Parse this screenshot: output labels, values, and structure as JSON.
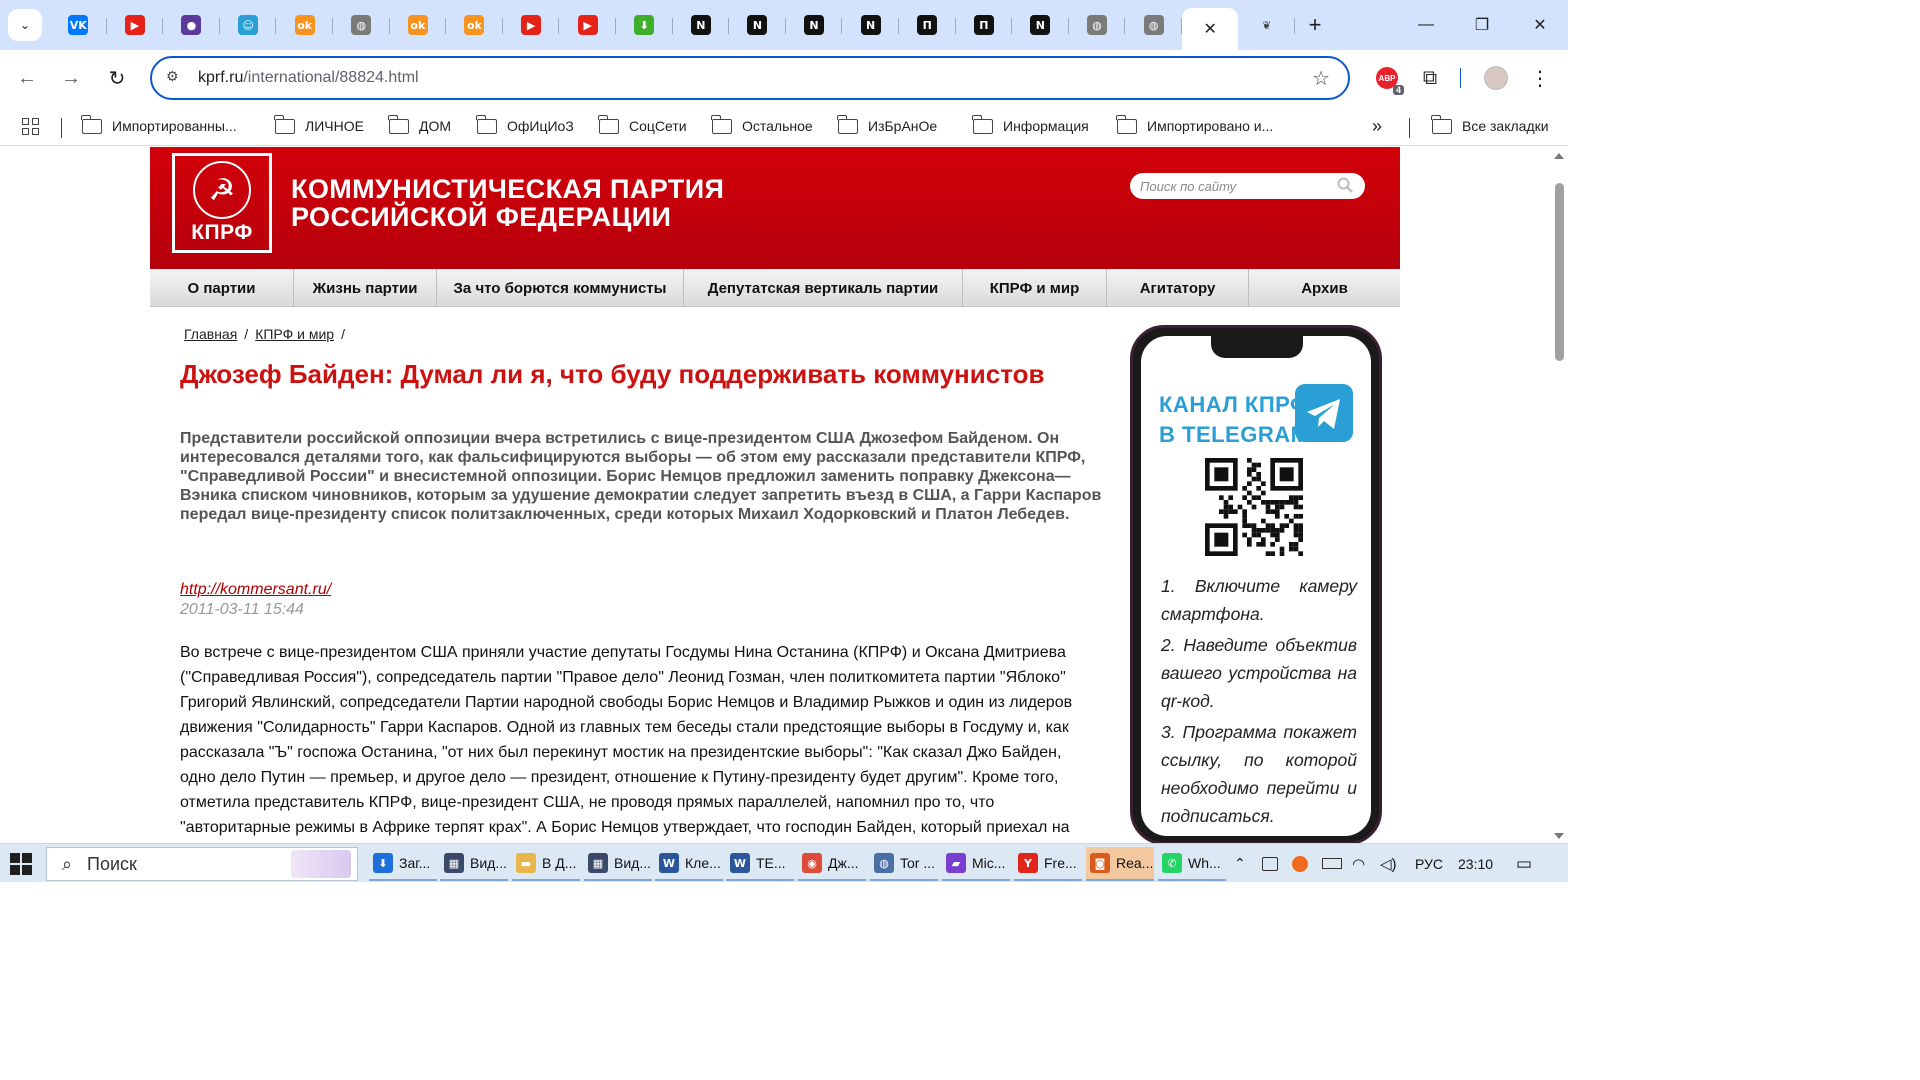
{
  "browser": {
    "tabs": [
      {
        "icon": "vk-icon",
        "glyph": "VK",
        "color": "#0077ff"
      },
      {
        "icon": "youtube-icon",
        "glyph": "▶",
        "color": "#e62117"
      },
      {
        "icon": "profile-icon",
        "glyph": "●",
        "color": "#5b3a9b"
      },
      {
        "icon": "smile-icon",
        "glyph": "☺",
        "color": "#2a9fd6"
      },
      {
        "icon": "ok-icon",
        "glyph": "ok",
        "color": "#f7931e"
      },
      {
        "icon": "globe-icon",
        "glyph": "◍",
        "color": "#7a7a7a"
      },
      {
        "icon": "ok-icon",
        "glyph": "ok",
        "color": "#f7931e"
      },
      {
        "icon": "ok-icon",
        "glyph": "ok",
        "color": "#f7931e"
      },
      {
        "icon": "youtube-icon",
        "glyph": "▶",
        "color": "#e62117"
      },
      {
        "icon": "youtube-icon",
        "glyph": "▶",
        "color": "#e62117"
      },
      {
        "icon": "download-icon",
        "glyph": "⬇",
        "color": "#3fae2a"
      },
      {
        "icon": "nf-icon",
        "glyph": "N",
        "color": "#111111"
      },
      {
        "icon": "nf-icon",
        "glyph": "N",
        "color": "#111111"
      },
      {
        "icon": "nf-icon",
        "glyph": "N",
        "color": "#111111"
      },
      {
        "icon": "nf-icon",
        "glyph": "N",
        "color": "#111111"
      },
      {
        "icon": "p-icon",
        "glyph": "П",
        "color": "#111111"
      },
      {
        "icon": "p-icon",
        "glyph": "П",
        "color": "#111111"
      },
      {
        "icon": "nf-icon",
        "glyph": "N",
        "color": "#111111"
      },
      {
        "icon": "globe-icon",
        "glyph": "◍",
        "color": "#7a7a7a"
      },
      {
        "icon": "globe-icon",
        "glyph": "◍",
        "color": "#7a7a7a"
      }
    ],
    "active_tab_close": "✕",
    "url_host": "kprf.ru",
    "url_path": "/international/88824.html",
    "extension_badge": "4",
    "bookmarks": [
      "Импортированны...",
      "ЛИЧНОЕ",
      "ДОМ",
      "ОфИцИоЗ",
      "СоцСети",
      "Остальное",
      "ИзБрАнОе",
      "Информация",
      "Импортировано и..."
    ],
    "bookmarks_more": "»",
    "all_bookmarks": "Все закладки"
  },
  "site": {
    "logo_text": "КПРФ",
    "title_line1": "КОММУНИСТИЧЕСКАЯ ПАРТИЯ",
    "title_line2": "РОССИЙСКОЙ ФЕДЕРАЦИИ",
    "search_placeholder": "Поиск по сайту",
    "nav": [
      "О партии",
      "Жизнь партии",
      "За что борются коммунисты",
      "Депутатская вертикаль партии",
      "КПРФ и мир",
      "Агитатору",
      "Архив"
    ],
    "brand_red": "#cc1111"
  },
  "breadcrumb": {
    "home": "Главная",
    "section": "КПРФ и мир",
    "sep": "/"
  },
  "article": {
    "title": "Джозеф Байден: Думал ли я, что буду поддерживать коммунистов",
    "lead": "Представители российской оппозиции вчера встретились с вице-президентом США Джозефом Байденом. Он интересовался деталями того, как фальсифицируются выборы — об этом ему рассказали представители КПРФ, \"Справедливой России\" и внесистемной оппозиции. Борис Немцов предложил заменить поправку Джексона—Вэника списком чиновников, которым за удушение демократии следует запретить въезд в США, а Гарри Каспаров передал вице-президенту список политзаключенных, среди которых Михаил Ходорковский и Платон Лебедев.",
    "source_link": "http://kommersant.ru/",
    "date": "2011-03-11 15:44",
    "body": "Во встрече с вице-президентом США приняли участие депутаты Госдумы Нина Останина (КПРФ) и Оксана Дмитриева (\"Справедливая Россия\"), сопредседатель партии \"Правое дело\" Леонид Гозман, член политкомитета партии \"Яблоко\" Григорий Явлинский, сопредседатели Партии народной свободы Борис Немцов и Владимир Рыжков и один из лидеров движения \"Солидарность\" Гарри Каспаров. Одной из главных тем беседы стали предстоящие выборы в Госдуму и, как рассказала \"Ъ\" госпожа Останина, \"от них был перекинут мостик на президентские выборы\": \"Как сказал Джо Байден, одно дело Путин — премьер, и другое дело — президент, отношение к Путину-президенту будет другим\". Кроме того, отметила представитель КПРФ, вице-президент США, не проводя прямых параллелей, напомнил про то, что \"авторитарные режимы в Африке терпят крах\". А Борис Немцов утверждает, что господин Байден, который приехал на"
  },
  "promo": {
    "title_line1": "КАНАЛ КПРФ",
    "title_line2": "В TELEGRAM",
    "steps": [
      "1. Включите камеру смартфона.",
      "2. Наведите объектив вашего устройства на qr-код.",
      "3. Программа покажет ссылку, по которой необходимо перейти и подписаться."
    ],
    "accent": "#2a9fd6"
  },
  "taskbar": {
    "search_label": "Поиск",
    "apps": [
      {
        "icon": "download-icon",
        "glyph": "⬇",
        "color": "#1e6fd9",
        "label": "Заг..."
      },
      {
        "icon": "video-icon",
        "glyph": "▦",
        "color": "#3b4a6b",
        "label": "Вид..."
      },
      {
        "icon": "folder-icon",
        "glyph": "▬",
        "color": "#e8b64a",
        "label": "В Д..."
      },
      {
        "icon": "video-icon",
        "glyph": "▦",
        "color": "#3b4a6b",
        "label": "Вид..."
      },
      {
        "icon": "word-icon",
        "glyph": "W",
        "color": "#2b579a",
        "label": "Кле..."
      },
      {
        "icon": "word-icon",
        "glyph": "W",
        "color": "#2b579a",
        "label": "TE..."
      },
      {
        "icon": "chrome-icon",
        "glyph": "◉",
        "color": "#dd4b39",
        "label": "Дж..."
      },
      {
        "icon": "tor-icon",
        "glyph": "◍",
        "color": "#4a6fa5",
        "label": "Tor ..."
      },
      {
        "icon": "clipchamp-icon",
        "glyph": "▰",
        "color": "#7a3fd1",
        "label": "Mic..."
      },
      {
        "icon": "yandex-icon",
        "glyph": "Y",
        "color": "#e0261b",
        "label": "Fre..."
      },
      {
        "icon": "reader-icon",
        "glyph": "◙",
        "color": "#d95b1e",
        "label": "Rea..."
      },
      {
        "icon": "whatsapp-icon",
        "glyph": "✆",
        "color": "#25d366",
        "label": "Wh..."
      }
    ],
    "lang": "РУС",
    "time": "23:10"
  }
}
